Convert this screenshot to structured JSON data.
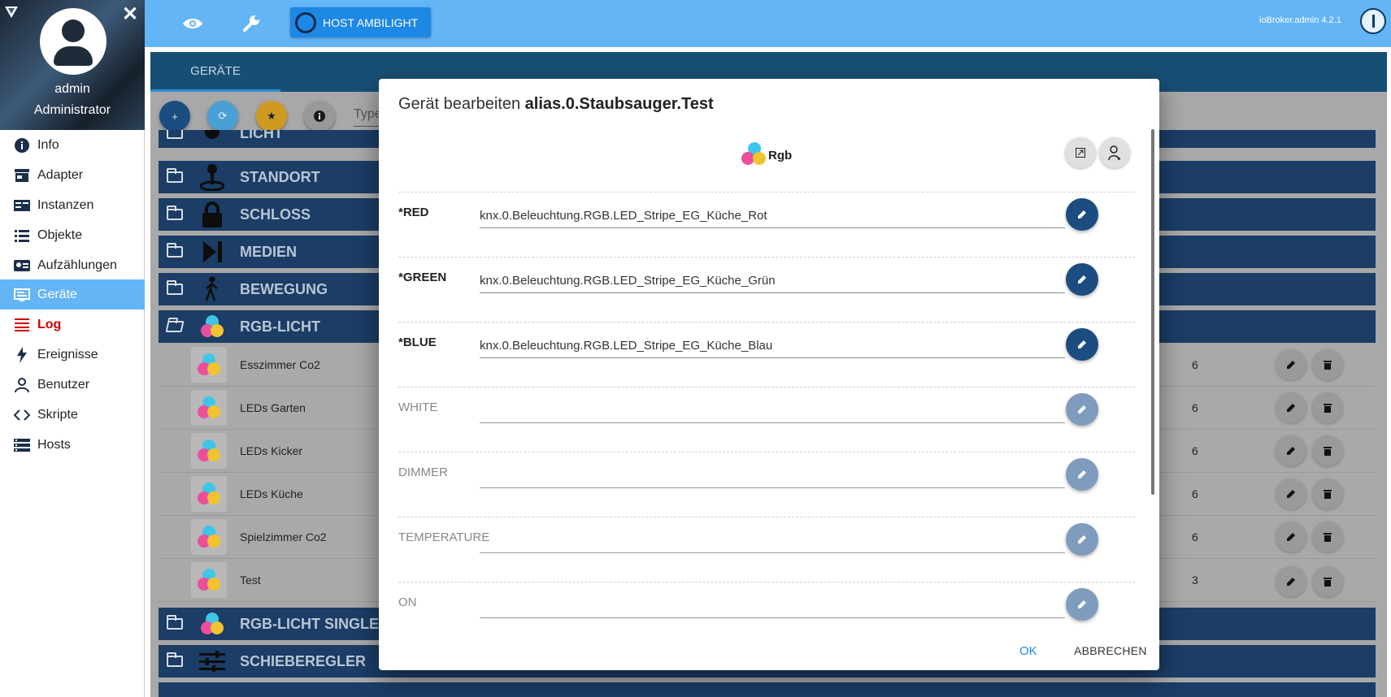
{
  "user": {
    "name": "admin",
    "role": "Administrator"
  },
  "sidebar": {
    "items": [
      {
        "label": "Info",
        "icon": "info-icon"
      },
      {
        "label": "Adapter",
        "icon": "store-icon"
      },
      {
        "label": "Instanzen",
        "icon": "instances-icon"
      },
      {
        "label": "Objekte",
        "icon": "list-icon"
      },
      {
        "label": "Aufzählungen",
        "icon": "enum-icon"
      },
      {
        "label": "Geräte",
        "icon": "devices-icon",
        "active": true
      },
      {
        "label": "Log",
        "icon": "log-icon"
      },
      {
        "label": "Ereignisse",
        "icon": "flash-icon"
      },
      {
        "label": "Benutzer",
        "icon": "user-icon"
      },
      {
        "label": "Skripte",
        "icon": "code-icon"
      },
      {
        "label": "Hosts",
        "icon": "hosts-icon"
      }
    ]
  },
  "topbar": {
    "host_button": "HOST AMBILIGHT",
    "version": "ioBroker.admin 4.2.1"
  },
  "main": {
    "tab": "GERÄTE",
    "filter_placeholder": "Type",
    "categories": [
      {
        "label": "LICHT"
      },
      {
        "label": "STANDORT"
      },
      {
        "label": "SCHLOSS"
      },
      {
        "label": "MEDIEN"
      },
      {
        "label": "BEWEGUNG"
      },
      {
        "label": "RGB-LICHT"
      },
      {
        "label": "RGB-LICHT SINGLE"
      },
      {
        "label": "SCHIEBEREGLER"
      }
    ],
    "devices": [
      {
        "name": "Esszimmer Co2",
        "count": "6"
      },
      {
        "name": "LEDs Garten",
        "count": "6"
      },
      {
        "name": "LEDs Kicker",
        "count": "6"
      },
      {
        "name": "LEDs Küche",
        "count": "6"
      },
      {
        "name": "Spielzimmer Co2",
        "count": "6"
      },
      {
        "name": "Test",
        "count": "3"
      }
    ]
  },
  "dialog": {
    "title_prefix": "Gerät bearbeiten ",
    "title_id": "alias.0.Staubsauger.Test",
    "type_label": "Rgb",
    "states": [
      {
        "name": "*RED",
        "value": "knx.0.Beleuchtung.RGB.LED_Stripe_EG_Küche_Rot",
        "required": true
      },
      {
        "name": "*GREEN",
        "value": "knx.0.Beleuchtung.RGB.LED_Stripe_EG_Küche_Grün",
        "required": true
      },
      {
        "name": "*BLUE",
        "value": "knx.0.Beleuchtung.RGB.LED_Stripe_EG_Küche_Blau",
        "required": true
      },
      {
        "name": "WHITE",
        "value": "",
        "required": false
      },
      {
        "name": "DIMMER",
        "value": "",
        "required": false
      },
      {
        "name": "TEMPERATURE",
        "value": "",
        "required": false
      },
      {
        "name": "ON",
        "value": "",
        "required": false
      }
    ],
    "ok_label": "OK",
    "cancel_label": "ABBRECHEN"
  },
  "colors": {
    "accent": "#64b5f6",
    "dialog_button": "#1b4d80",
    "category": "#1b3d66",
    "log_red": "#cc0000"
  }
}
